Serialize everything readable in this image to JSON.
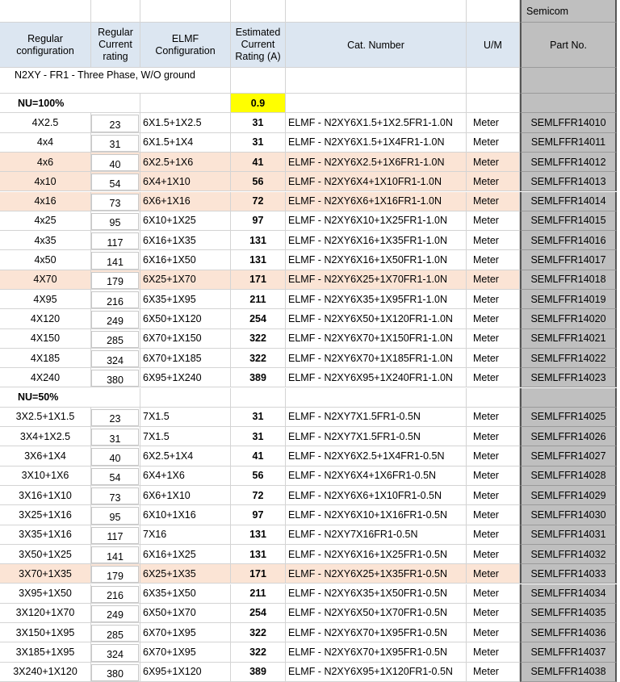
{
  "header": {
    "brand": "Semicom",
    "col_regular_config": "Regular configuration",
    "col_regular_current": "Regular Current rating",
    "col_elmf_config": "ELMF Configuration",
    "col_estimated": "Estimated Current Rating (A)",
    "col_cat_number": "Cat. Number",
    "col_um": "U/M",
    "col_part_no": "Part No."
  },
  "section_title": "N2XY - FR1 - Three Phase, W/O ground",
  "groups": [
    {
      "label": "NU=100%",
      "factor": "0.9",
      "rows": [
        {
          "cfg": "4X2.5",
          "reg": "23",
          "elmf": "6X1.5+1X2.5",
          "est": "31",
          "cat": "ELMF - N2XY6X1.5+1X2.5FR1-1.0N",
          "um": "Meter",
          "part": "SEMLFFR14010",
          "hl": false
        },
        {
          "cfg": "4x4",
          "reg": "31",
          "elmf": "6X1.5+1X4",
          "est": "31",
          "cat": "ELMF - N2XY6X1.5+1X4FR1-1.0N",
          "um": "Meter",
          "part": "SEMLFFR14011",
          "hl": false
        },
        {
          "cfg": "4x6",
          "reg": "40",
          "elmf": "6X2.5+1X6",
          "est": "41",
          "cat": "ELMF - N2XY6X2.5+1X6FR1-1.0N",
          "um": "Meter",
          "part": "SEMLFFR14012",
          "hl": true
        },
        {
          "cfg": "4x10",
          "reg": "54",
          "elmf": "6X4+1X10",
          "est": "56",
          "cat": "ELMF - N2XY6X4+1X10FR1-1.0N",
          "um": "Meter",
          "part": "SEMLFFR14013",
          "hl": true
        },
        {
          "cfg": "4x16",
          "reg": "73",
          "elmf": "6X6+1X16",
          "est": "72",
          "cat": "ELMF - N2XY6X6+1X16FR1-1.0N",
          "um": "Meter",
          "part": "SEMLFFR14014",
          "hl": true
        },
        {
          "cfg": "4x25",
          "reg": "95",
          "elmf": "6X10+1X25",
          "est": "97",
          "cat": "ELMF - N2XY6X10+1X25FR1-1.0N",
          "um": "Meter",
          "part": "SEMLFFR14015",
          "hl": false
        },
        {
          "cfg": "4x35",
          "reg": "117",
          "elmf": "6X16+1X35",
          "est": "131",
          "cat": "ELMF - N2XY6X16+1X35FR1-1.0N",
          "um": "Meter",
          "part": "SEMLFFR14016",
          "hl": false
        },
        {
          "cfg": "4x50",
          "reg": "141",
          "elmf": "6X16+1X50",
          "est": "131",
          "cat": "ELMF - N2XY6X16+1X50FR1-1.0N",
          "um": "Meter",
          "part": "SEMLFFR14017",
          "hl": false
        },
        {
          "cfg": "4X70",
          "reg": "179",
          "elmf": "6X25+1X70",
          "est": "171",
          "cat": "ELMF - N2XY6X25+1X70FR1-1.0N",
          "um": "Meter",
          "part": "SEMLFFR14018",
          "hl": true
        },
        {
          "cfg": "4X95",
          "reg": "216",
          "elmf": "6X35+1X95",
          "est": "211",
          "cat": "ELMF - N2XY6X35+1X95FR1-1.0N",
          "um": "Meter",
          "part": "SEMLFFR14019",
          "hl": false
        },
        {
          "cfg": "4X120",
          "reg": "249",
          "elmf": "6X50+1X120",
          "est": "254",
          "cat": "ELMF - N2XY6X50+1X120FR1-1.0N",
          "um": "Meter",
          "part": "SEMLFFR14020",
          "hl": false
        },
        {
          "cfg": "4X150",
          "reg": "285",
          "elmf": "6X70+1X150",
          "est": "322",
          "cat": "ELMF - N2XY6X70+1X150FR1-1.0N",
          "um": "Meter",
          "part": "SEMLFFR14021",
          "hl": false
        },
        {
          "cfg": "4X185",
          "reg": "324",
          "elmf": "6X70+1X185",
          "est": "322",
          "cat": "ELMF - N2XY6X70+1X185FR1-1.0N",
          "um": "Meter",
          "part": "SEMLFFR14022",
          "hl": false
        },
        {
          "cfg": "4X240",
          "reg": "380",
          "elmf": "6X95+1X240",
          "est": "389",
          "cat": "ELMF - N2XY6X95+1X240FR1-1.0N",
          "um": "Meter",
          "part": "SEMLFFR14023",
          "hl": false
        }
      ]
    },
    {
      "label": "NU=50%",
      "factor": "",
      "rows": [
        {
          "cfg": "3X2.5+1X1.5",
          "reg": "23",
          "elmf": "7X1.5",
          "est": "31",
          "cat": "ELMF - N2XY7X1.5FR1-0.5N",
          "um": "Meter",
          "part": "SEMLFFR14025",
          "hl": false
        },
        {
          "cfg": "3X4+1X2.5",
          "reg": "31",
          "elmf": "7X1.5",
          "est": "31",
          "cat": "ELMF - N2XY7X1.5FR1-0.5N",
          "um": "Meter",
          "part": "SEMLFFR14026",
          "hl": false
        },
        {
          "cfg": "3X6+1X4",
          "reg": "40",
          "elmf": "6X2.5+1X4",
          "est": "41",
          "cat": "ELMF - N2XY6X2.5+1X4FR1-0.5N",
          "um": "Meter",
          "part": "SEMLFFR14027",
          "hl": false
        },
        {
          "cfg": "3X10+1X6",
          "reg": "54",
          "elmf": "6X4+1X6",
          "est": "56",
          "cat": "ELMF - N2XY6X4+1X6FR1-0.5N",
          "um": "Meter",
          "part": "SEMLFFR14028",
          "hl": false
        },
        {
          "cfg": "3X16+1X10",
          "reg": "73",
          "elmf": "6X6+1X10",
          "est": "72",
          "cat": "ELMF - N2XY6X6+1X10FR1-0.5N",
          "um": "Meter",
          "part": "SEMLFFR14029",
          "hl": false
        },
        {
          "cfg": "3X25+1X16",
          "reg": "95",
          "elmf": "6X10+1X16",
          "est": "97",
          "cat": "ELMF - N2XY6X10+1X16FR1-0.5N",
          "um": "Meter",
          "part": "SEMLFFR14030",
          "hl": false
        },
        {
          "cfg": "3X35+1X16",
          "reg": "117",
          "elmf": "7X16",
          "est": "131",
          "cat": "ELMF - N2XY7X16FR1-0.5N",
          "um": "Meter",
          "part": "SEMLFFR14031",
          "hl": false
        },
        {
          "cfg": "3X50+1X25",
          "reg": "141",
          "elmf": "6X16+1X25",
          "est": "131",
          "cat": "ELMF - N2XY6X16+1X25FR1-0.5N",
          "um": "Meter",
          "part": "SEMLFFR14032",
          "hl": false
        },
        {
          "cfg": "3X70+1X35",
          "reg": "179",
          "elmf": "6X25+1X35",
          "est": "171",
          "cat": "ELMF - N2XY6X25+1X35FR1-0.5N",
          "um": "Meter",
          "part": "SEMLFFR14033",
          "hl": true
        },
        {
          "cfg": "3X95+1X50",
          "reg": "216",
          "elmf": "6X35+1X50",
          "est": "211",
          "cat": "ELMF - N2XY6X35+1X50FR1-0.5N",
          "um": "Meter",
          "part": "SEMLFFR14034",
          "hl": false
        },
        {
          "cfg": "3X120+1X70",
          "reg": "249",
          "elmf": "6X50+1X70",
          "est": "254",
          "cat": "ELMF - N2XY6X50+1X70FR1-0.5N",
          "um": "Meter",
          "part": "SEMLFFR14035",
          "hl": false
        },
        {
          "cfg": "3X150+1X95",
          "reg": "285",
          "elmf": "6X70+1X95",
          "est": "322",
          "cat": "ELMF - N2XY6X70+1X95FR1-0.5N",
          "um": "Meter",
          "part": "SEMLFFR14036",
          "hl": false
        },
        {
          "cfg": "3X185+1X95",
          "reg": "324",
          "elmf": "6X70+1X95",
          "est": "322",
          "cat": "ELMF - N2XY6X70+1X95FR1-0.5N",
          "um": "Meter",
          "part": "SEMLFFR14037",
          "hl": false
        },
        {
          "cfg": "3X240+1X120",
          "reg": "380",
          "elmf": "6X95+1X120",
          "est": "389",
          "cat": "ELMF - N2XY6X95+1X120FR1-0.5N",
          "um": "Meter",
          "part": "SEMLFFR14038",
          "hl": false
        }
      ]
    }
  ],
  "colors": {
    "header_bg": "#dce6f1",
    "highlight_bg": "#fbe4d5",
    "factor_bg": "#ffff00",
    "part_col_bg": "#bfbfbf"
  }
}
